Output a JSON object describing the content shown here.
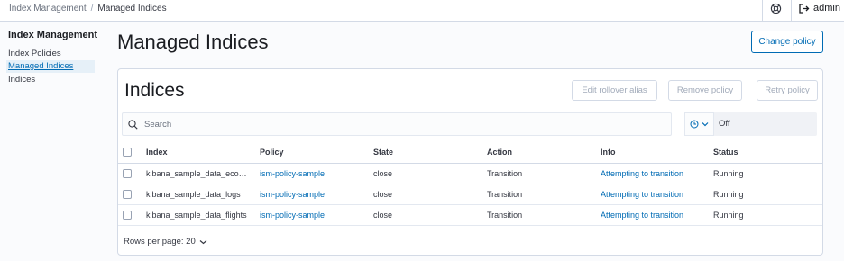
{
  "header": {
    "breadcrumbs": [
      "Index Management",
      "Managed Indices"
    ],
    "user_label": "admin",
    "help_icon": "help-icon",
    "logout_icon": "logout-icon"
  },
  "sidebar": {
    "title": "Index Management",
    "items": [
      {
        "label": "Index Policies",
        "active": false
      },
      {
        "label": "Managed Indices",
        "active": true
      },
      {
        "label": "Indices",
        "active": false
      }
    ]
  },
  "main": {
    "title": "Managed Indices",
    "change_policy_label": "Change policy"
  },
  "panel": {
    "title": "Indices",
    "actions": [
      {
        "label": "Edit rollover alias",
        "enabled": false
      },
      {
        "label": "Remove policy",
        "enabled": false
      },
      {
        "label": "Retry policy",
        "enabled": false
      }
    ],
    "search": {
      "placeholder": "Search",
      "value": ""
    },
    "refresh": {
      "icon": "clock-icon",
      "value": "Off"
    }
  },
  "table": {
    "columns": [
      "Index",
      "Policy",
      "State",
      "Action",
      "Info",
      "Status"
    ],
    "rows": [
      {
        "index": "kibana_sample_data_ecommerce",
        "policy": "ism-policy-sample",
        "state": "close",
        "action": "Transition",
        "info": "Attempting to transition",
        "status": "Running"
      },
      {
        "index": "kibana_sample_data_logs",
        "policy": "ism-policy-sample",
        "state": "close",
        "action": "Transition",
        "info": "Attempting to transition",
        "status": "Running"
      },
      {
        "index": "kibana_sample_data_flights",
        "policy": "ism-policy-sample",
        "state": "close",
        "action": "Transition",
        "info": "Attempting to transition",
        "status": "Running"
      }
    ]
  },
  "pagination": {
    "rows_per_page_label": "Rows per page: 20"
  },
  "colors": {
    "accent": "#006bb4",
    "border": "#d3dae6",
    "disabled_text": "#a2abba",
    "active_nav_bg": "#e6f0f8"
  }
}
